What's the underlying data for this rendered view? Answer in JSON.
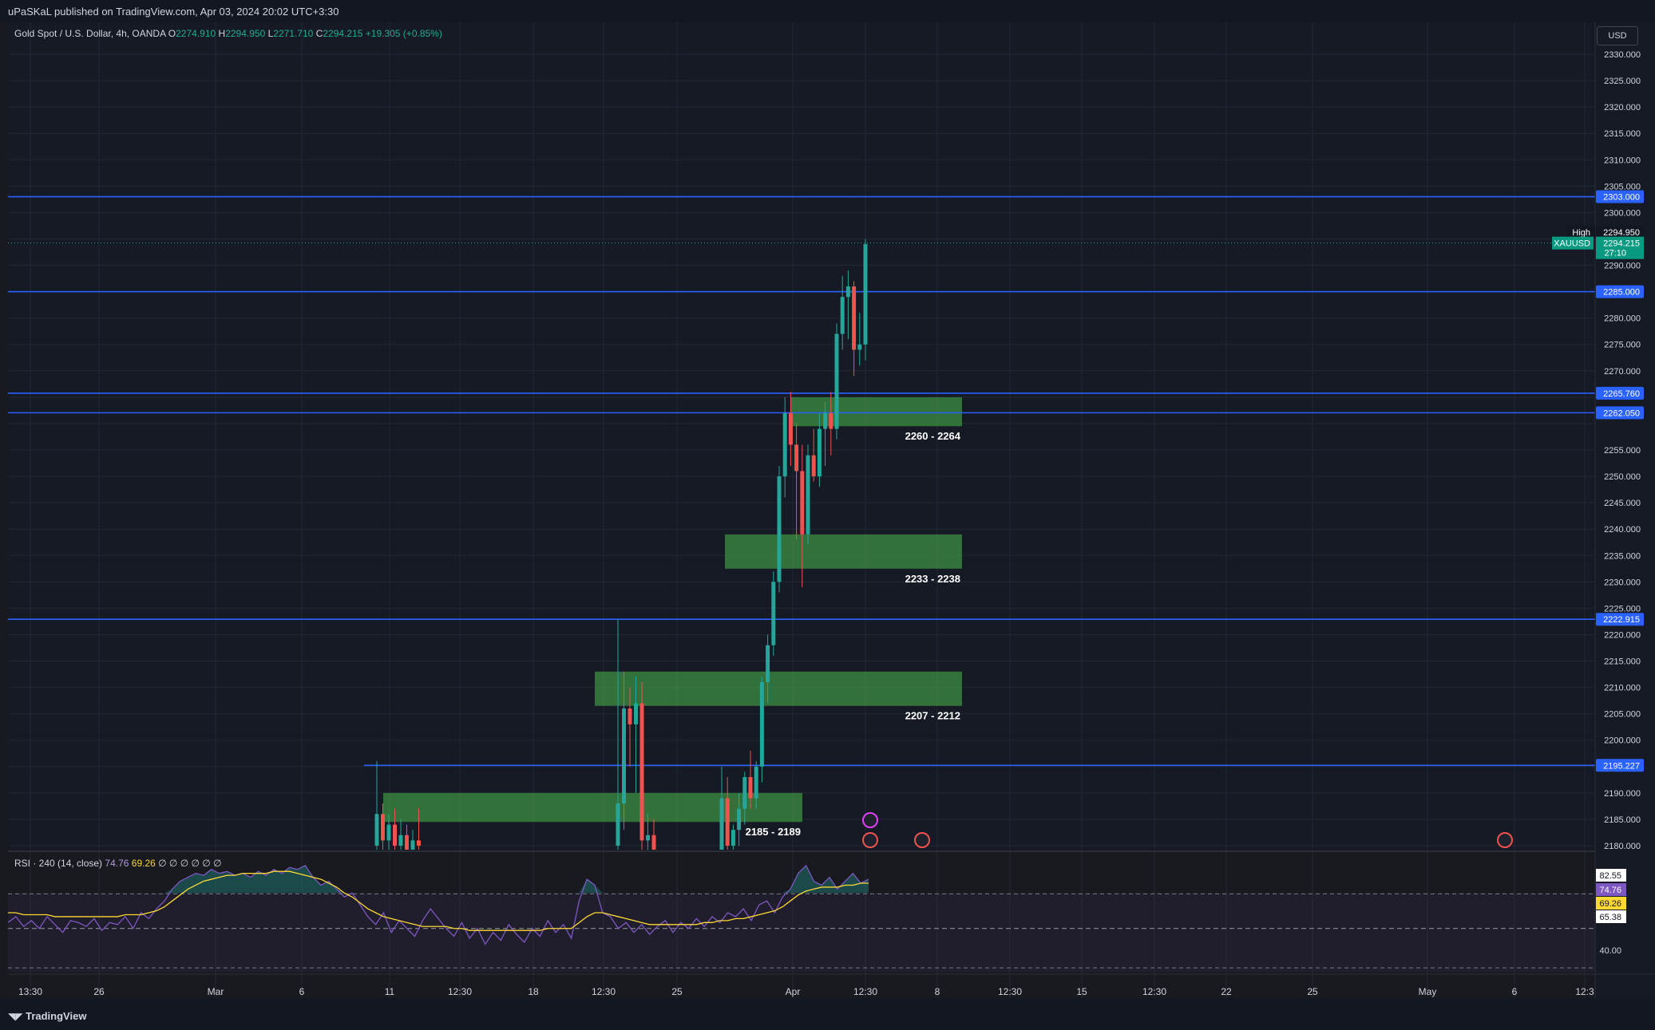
{
  "publisher_line": "uPaSKaL published on TradingView.com, Apr 03, 2024 20:02 UTC+3:30",
  "legend": {
    "symbol": "Gold Spot / U.S. Dollar, 4h, OANDA",
    "open_label": "O",
    "open": "2274.910",
    "high_label": "H",
    "high": "2294.950",
    "low_label": "L",
    "low": "2271.710",
    "close_label": "C",
    "close": "2294.215",
    "change": "+19.305 (+0.85%)"
  },
  "currency_button": "USD",
  "rsi_legend": {
    "title": "RSI · 240 (14, close)",
    "value1": "74.76",
    "value2": "69.26",
    "placeholders": "∅ ∅ ∅ ∅ ∅ ∅"
  },
  "brand": "TradingView",
  "colors": {
    "bg": "#161a25",
    "grid": "#232733",
    "up": "#26a69a",
    "down": "#ef5350",
    "level": "#2962ff",
    "zone": "#43a047",
    "rsi": "#7e57c2",
    "rsi_ma": "#fdd835"
  },
  "chart_data": {
    "type": "candlestick",
    "price_axis": {
      "ticks": [
        "2330.000",
        "2325.000",
        "2320.000",
        "2315.000",
        "2310.000",
        "2305.000",
        "2300.000",
        "2290.000",
        "2280.000",
        "2275.000",
        "2270.000",
        "2255.000",
        "2250.000",
        "2245.000",
        "2240.000",
        "2235.000",
        "2230.000",
        "2225.000",
        "2220.000",
        "2215.000",
        "2210.000",
        "2205.000",
        "2200.000",
        "2190.000",
        "2185.000",
        "2180.000"
      ],
      "range": [
        2179,
        2335
      ]
    },
    "time_axis": {
      "ticks": [
        "13:30",
        "26",
        "Mar",
        "6",
        "11",
        "12:30",
        "18",
        "12:30",
        "25",
        "Apr",
        "12:30",
        "8",
        "12:30",
        "15",
        "12:30",
        "22",
        "25",
        "May",
        "6",
        "12:3"
      ]
    },
    "horizontal_levels": [
      {
        "price": 2303.0,
        "label": "2303.000"
      },
      {
        "price": 2285.0,
        "label": "2285.000"
      },
      {
        "price": 2265.76,
        "label": "2265.760"
      },
      {
        "price": 2262.05,
        "label": "2262.050"
      },
      {
        "price": 2222.915,
        "label": "2222.915"
      },
      {
        "price": 2195.227,
        "label": "2195.227"
      }
    ],
    "price_tags": [
      {
        "name": "High",
        "value": "2294.950"
      },
      {
        "name": "XAUUSD",
        "value": "2294.215",
        "countdown": "27:10"
      }
    ],
    "zones": [
      {
        "low": 2260,
        "high": 2264,
        "label": "2260 - 2264"
      },
      {
        "low": 2233,
        "high": 2238,
        "label": "2233 - 2238"
      },
      {
        "low": 2207,
        "high": 2212,
        "label": "2207 - 2212"
      },
      {
        "low": 2185,
        "high": 2189,
        "label": "2185 - 2189"
      }
    ],
    "candles": [
      {
        "o": 2180,
        "h": 2196,
        "l": 2178,
        "c": 2186
      },
      {
        "o": 2186,
        "h": 2188,
        "l": 2179,
        "c": 2181
      },
      {
        "o": 2181,
        "h": 2186,
        "l": 2178,
        "c": 2184
      },
      {
        "o": 2184,
        "h": 2187,
        "l": 2178,
        "c": 2180
      },
      {
        "o": 2180,
        "h": 2185,
        "l": 2178,
        "c": 2182
      },
      {
        "o": 2182,
        "h": 2184,
        "l": 2178,
        "c": 2179
      },
      {
        "o": 2179,
        "h": 2183,
        "l": 2176,
        "c": 2181
      },
      {
        "o": 2181,
        "h": 2187,
        "l": 2179,
        "c": 2180
      },
      {
        "o": 2180,
        "h": 2223,
        "l": 2177,
        "c": 2188
      },
      {
        "o": 2188,
        "h": 2213,
        "l": 2183,
        "c": 2206
      },
      {
        "o": 2206,
        "h": 2210,
        "l": 2195,
        "c": 2203
      },
      {
        "o": 2203,
        "h": 2212,
        "l": 2190,
        "c": 2207
      },
      {
        "o": 2207,
        "h": 2211,
        "l": 2175,
        "c": 2181
      },
      {
        "o": 2181,
        "h": 2186,
        "l": 2176,
        "c": 2182
      },
      {
        "o": 2182,
        "h": 2185,
        "l": 2176,
        "c": 2178
      },
      {
        "o": 2178,
        "h": 2195,
        "l": 2176,
        "c": 2189
      },
      {
        "o": 2189,
        "h": 2193,
        "l": 2177,
        "c": 2180
      },
      {
        "o": 2180,
        "h": 2184,
        "l": 2175,
        "c": 2183
      },
      {
        "o": 2183,
        "h": 2190,
        "l": 2180,
        "c": 2187
      },
      {
        "o": 2187,
        "h": 2194,
        "l": 2184,
        "c": 2193
      },
      {
        "o": 2193,
        "h": 2198,
        "l": 2187,
        "c": 2189
      },
      {
        "o": 2189,
        "h": 2196,
        "l": 2187,
        "c": 2195
      },
      {
        "o": 2195,
        "h": 2212,
        "l": 2192,
        "c": 2211
      },
      {
        "o": 2211,
        "h": 2220,
        "l": 2207,
        "c": 2218
      },
      {
        "o": 2218,
        "h": 2232,
        "l": 2216,
        "c": 2230
      },
      {
        "o": 2230,
        "h": 2252,
        "l": 2228,
        "c": 2250
      },
      {
        "o": 2250,
        "h": 2265,
        "l": 2246,
        "c": 2262
      },
      {
        "o": 2262,
        "h": 2266,
        "l": 2252,
        "c": 2256
      },
      {
        "o": 2256,
        "h": 2260,
        "l": 2238,
        "c": 2251
      },
      {
        "o": 2251,
        "h": 2256,
        "l": 2229,
        "c": 2239
      },
      {
        "o": 2239,
        "h": 2256,
        "l": 2237,
        "c": 2254
      },
      {
        "o": 2254,
        "h": 2259,
        "l": 2249,
        "c": 2250
      },
      {
        "o": 2250,
        "h": 2262,
        "l": 2248,
        "c": 2259
      },
      {
        "o": 2259,
        "h": 2264,
        "l": 2252,
        "c": 2262
      },
      {
        "o": 2262,
        "h": 2266,
        "l": 2254,
        "c": 2259
      },
      {
        "o": 2259,
        "h": 2279,
        "l": 2257,
        "c": 2277
      },
      {
        "o": 2277,
        "h": 2288,
        "l": 2274,
        "c": 2284
      },
      {
        "o": 2284,
        "h": 2289,
        "l": 2276,
        "c": 2286
      },
      {
        "o": 2286,
        "h": 2287,
        "l": 2269,
        "c": 2274
      },
      {
        "o": 2274,
        "h": 2281,
        "l": 2271,
        "c": 2275
      },
      {
        "o": 2275,
        "h": 2295,
        "l": 2272,
        "c": 2294
      }
    ],
    "rsi": {
      "levels": {
        "upper": 70,
        "lower": 30,
        "label": "40.00"
      },
      "axis_labels": [
        "82.55",
        "74.76",
        "69.26",
        "65.38",
        "40.00"
      ],
      "values": [
        55,
        58,
        53,
        56,
        52,
        58,
        54,
        50,
        56,
        55,
        53,
        57,
        51,
        55,
        54,
        58,
        52,
        60,
        57,
        62,
        66,
        72,
        76,
        78,
        80,
        79,
        82,
        80,
        81,
        79,
        80,
        78,
        81,
        79,
        82,
        80,
        83,
        82,
        84,
        78,
        74,
        76,
        72,
        68,
        70,
        64,
        58,
        54,
        60,
        50,
        56,
        52,
        48,
        56,
        62,
        57,
        52,
        48,
        55,
        47,
        52,
        44,
        50,
        46,
        54,
        49,
        45,
        52,
        48,
        56,
        50,
        54,
        47,
        66,
        77,
        74,
        60,
        58,
        52,
        55,
        50,
        54,
        49,
        53,
        56,
        50,
        55,
        52,
        57,
        53,
        58,
        55,
        60,
        58,
        62,
        56,
        64,
        66,
        60,
        68,
        72,
        80,
        84,
        76,
        74,
        78,
        72,
        76,
        80,
        75,
        77
      ]
    },
    "rsi_ma": {
      "values": [
        60,
        60,
        59,
        59,
        59,
        59,
        58,
        58,
        58,
        58,
        58,
        58,
        58,
        58,
        58,
        59,
        59,
        59,
        60,
        61,
        63,
        66,
        69,
        72,
        74,
        76,
        77,
        78,
        79,
        79,
        80,
        80,
        80,
        80,
        81,
        81,
        81,
        80,
        79,
        78,
        77,
        75,
        73,
        70,
        68,
        65,
        62,
        60,
        58,
        57,
        56,
        55,
        54,
        53,
        53,
        53,
        53,
        52,
        52,
        51,
        51,
        51,
        51,
        51,
        51,
        51,
        51,
        51,
        51,
        52,
        52,
        52,
        52,
        55,
        58,
        60,
        60,
        59,
        58,
        57,
        56,
        55,
        54,
        54,
        54,
        54,
        54,
        54,
        54,
        55,
        55,
        56,
        56,
        57,
        57,
        58,
        59,
        60,
        61,
        63,
        66,
        69,
        71,
        72,
        73,
        73,
        73,
        74,
        74,
        75,
        75
      ]
    }
  }
}
